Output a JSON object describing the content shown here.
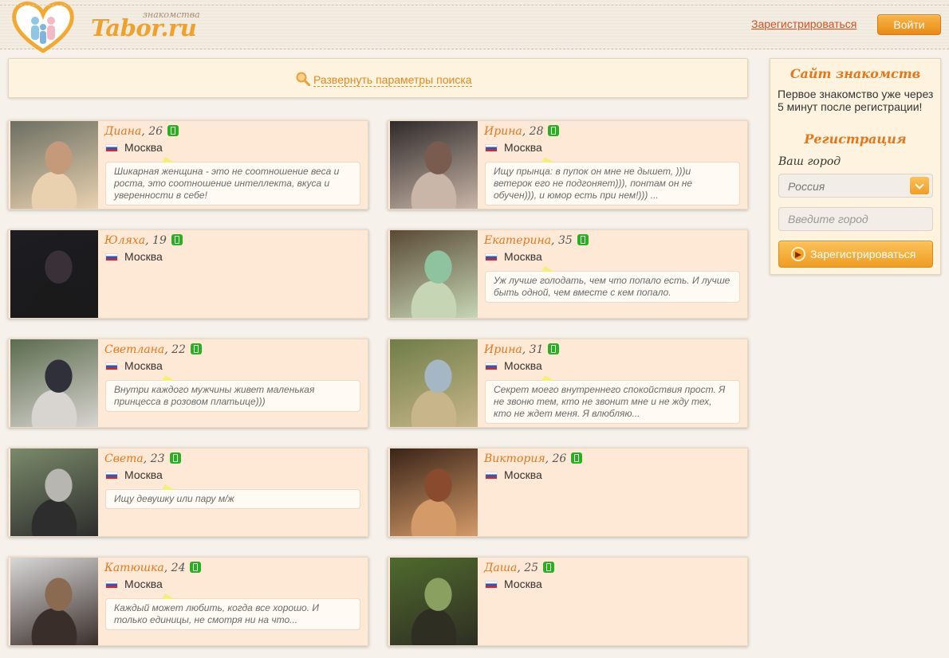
{
  "header": {
    "logo_small": "знакомства",
    "logo_text": "Tabor.ru",
    "register_link": "Зарегистрироваться",
    "login_button": "Войти"
  },
  "search": {
    "expand_link": "Развернуть параметры поиска"
  },
  "profiles": [
    {
      "name": "Диана",
      "age": ", 26",
      "city": "Москва",
      "quote": "Шикарная женщина - это не соотношение веса и роста, это соотношение интеллекта, вкуса и уверенности в себе!"
    },
    {
      "name": "Ирина",
      "age": ", 28",
      "city": "Москва",
      "quote": "Ищу прынца: в пупок он мне не дышет, )))и ветерок его не подгоняет))), понтам он не обучен))), и юмор есть при нем!))) ..."
    },
    {
      "name": "Юляха",
      "age": ", 19",
      "city": "Москва",
      "quote": ""
    },
    {
      "name": "Екатерина",
      "age": ", 35",
      "city": "Москва",
      "quote": "Уж лучше голодать, чем что попало есть. И лучше быть одной, чем вместе с кем попало."
    },
    {
      "name": "Светлана",
      "age": ", 22",
      "city": "Москва",
      "quote": "Внутри каждого мужчины живет маленькая принцесса в розовом платьице)))"
    },
    {
      "name": "Ирина",
      "age": ", 31",
      "city": "Москва",
      "quote": "Секрет моего внутреннего спокойствия прост. Я не звоню тем, кто не звонит мне и не жду тех, кто не ждет меня. Я влюбляю..."
    },
    {
      "name": "Света",
      "age": ", 23",
      "city": "Москва",
      "quote": "Ищу девушку или пару м/ж"
    },
    {
      "name": "Виктория",
      "age": ", 26",
      "city": "Москва",
      "quote": ""
    },
    {
      "name": "Катюшка",
      "age": ", 24",
      "city": "Москва",
      "quote": "Каждый может любить, когда все хорошо. И только единицы, не смотря ни на что..."
    },
    {
      "name": "Даша",
      "age": ", 25",
      "city": "Москва",
      "quote": ""
    }
  ],
  "sidebar": {
    "title": "Сайт знакомств",
    "text": "Первое знакомство уже через 5 минут после регистрации!",
    "reg_title": "Регистрация",
    "city_label": "Ваш город",
    "country_value": "Россия",
    "city_placeholder": "Введите город",
    "register_button": "Зарегистрироваться"
  },
  "colors": {
    "accent": "#e4771b",
    "card_bg": "#fde9d6",
    "button_orange": "#ef9d22",
    "online_green": "#27b11f"
  }
}
